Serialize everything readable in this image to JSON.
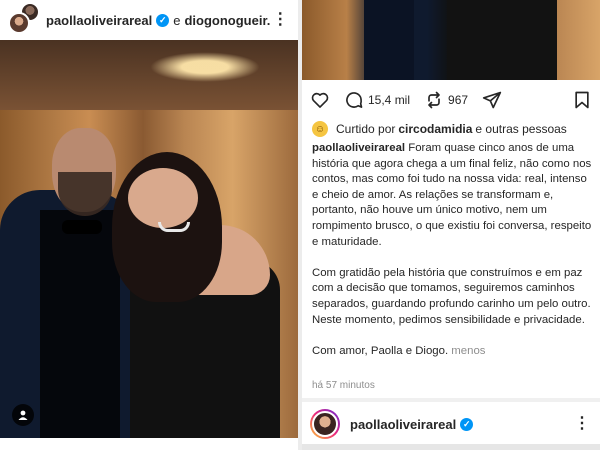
{
  "left_post": {
    "header": {
      "author": "paollaoliveirareal",
      "conjunction": "e",
      "coauthor": "diogonogueir..."
    }
  },
  "right_post": {
    "actions": {
      "comments_count": "15,4 mil",
      "shares_count": "967"
    },
    "liked_by": {
      "prefix": "Curtido por",
      "user": "circodamidia",
      "suffix": "e outras pessoas"
    },
    "caption": {
      "author": "paollaoliveirareal",
      "paragraph1": "Foram quase cinco anos de uma história que agora chega a um final feliz, não como nos contos, mas como foi tudo na nossa vida: real, intenso e cheio de amor. As relações se transformam e, portanto, não houve um único motivo, nem um rompimento brusco, o que existiu foi conversa, respeito e maturidade.",
      "paragraph2": "Com gratidão pela história que construímos e em paz com a decisão que tomamos, seguiremos caminhos separados, guardando profundo carinho um pelo outro. Neste momento, pedimos sensibilidade e privacidade.",
      "paragraph3": "Com amor, Paolla e Diogo.",
      "less_link": "menos"
    },
    "timestamp": "há 57 minutos"
  },
  "next_post": {
    "author": "paollaoliveirareal"
  },
  "colors": {
    "verified": "#0095f6",
    "text": "#262626",
    "muted": "#8e8e8e"
  }
}
